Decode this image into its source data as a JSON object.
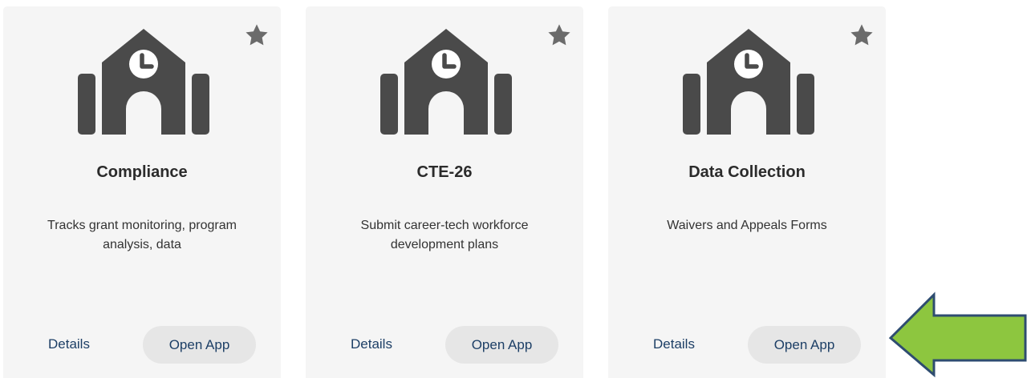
{
  "cards": [
    {
      "title": "Compliance",
      "description": "Tracks grant monitoring, program analysis, data",
      "details_label": "Details",
      "open_label": "Open App",
      "icon": "school-building-clock-icon",
      "favorite_icon": "star-icon"
    },
    {
      "title": "CTE-26",
      "description": "Submit career-tech workforce development plans",
      "details_label": "Details",
      "open_label": "Open App",
      "icon": "school-building-clock-icon",
      "favorite_icon": "star-icon"
    },
    {
      "title": "Data Collection",
      "description": "Waivers and Appeals Forms",
      "details_label": "Details",
      "open_label": "Open App",
      "icon": "school-building-clock-icon",
      "favorite_icon": "star-icon"
    }
  ],
  "annotation": {
    "icon": "left-arrow-icon",
    "fill": "#8dc63f",
    "stroke": "#2e4c70"
  },
  "colors": {
    "card_bg": "#f5f5f5",
    "icon": "#4a4a4a",
    "star": "#6b6b6b",
    "link": "#1d3f66",
    "button_bg": "#e6e6e6"
  }
}
